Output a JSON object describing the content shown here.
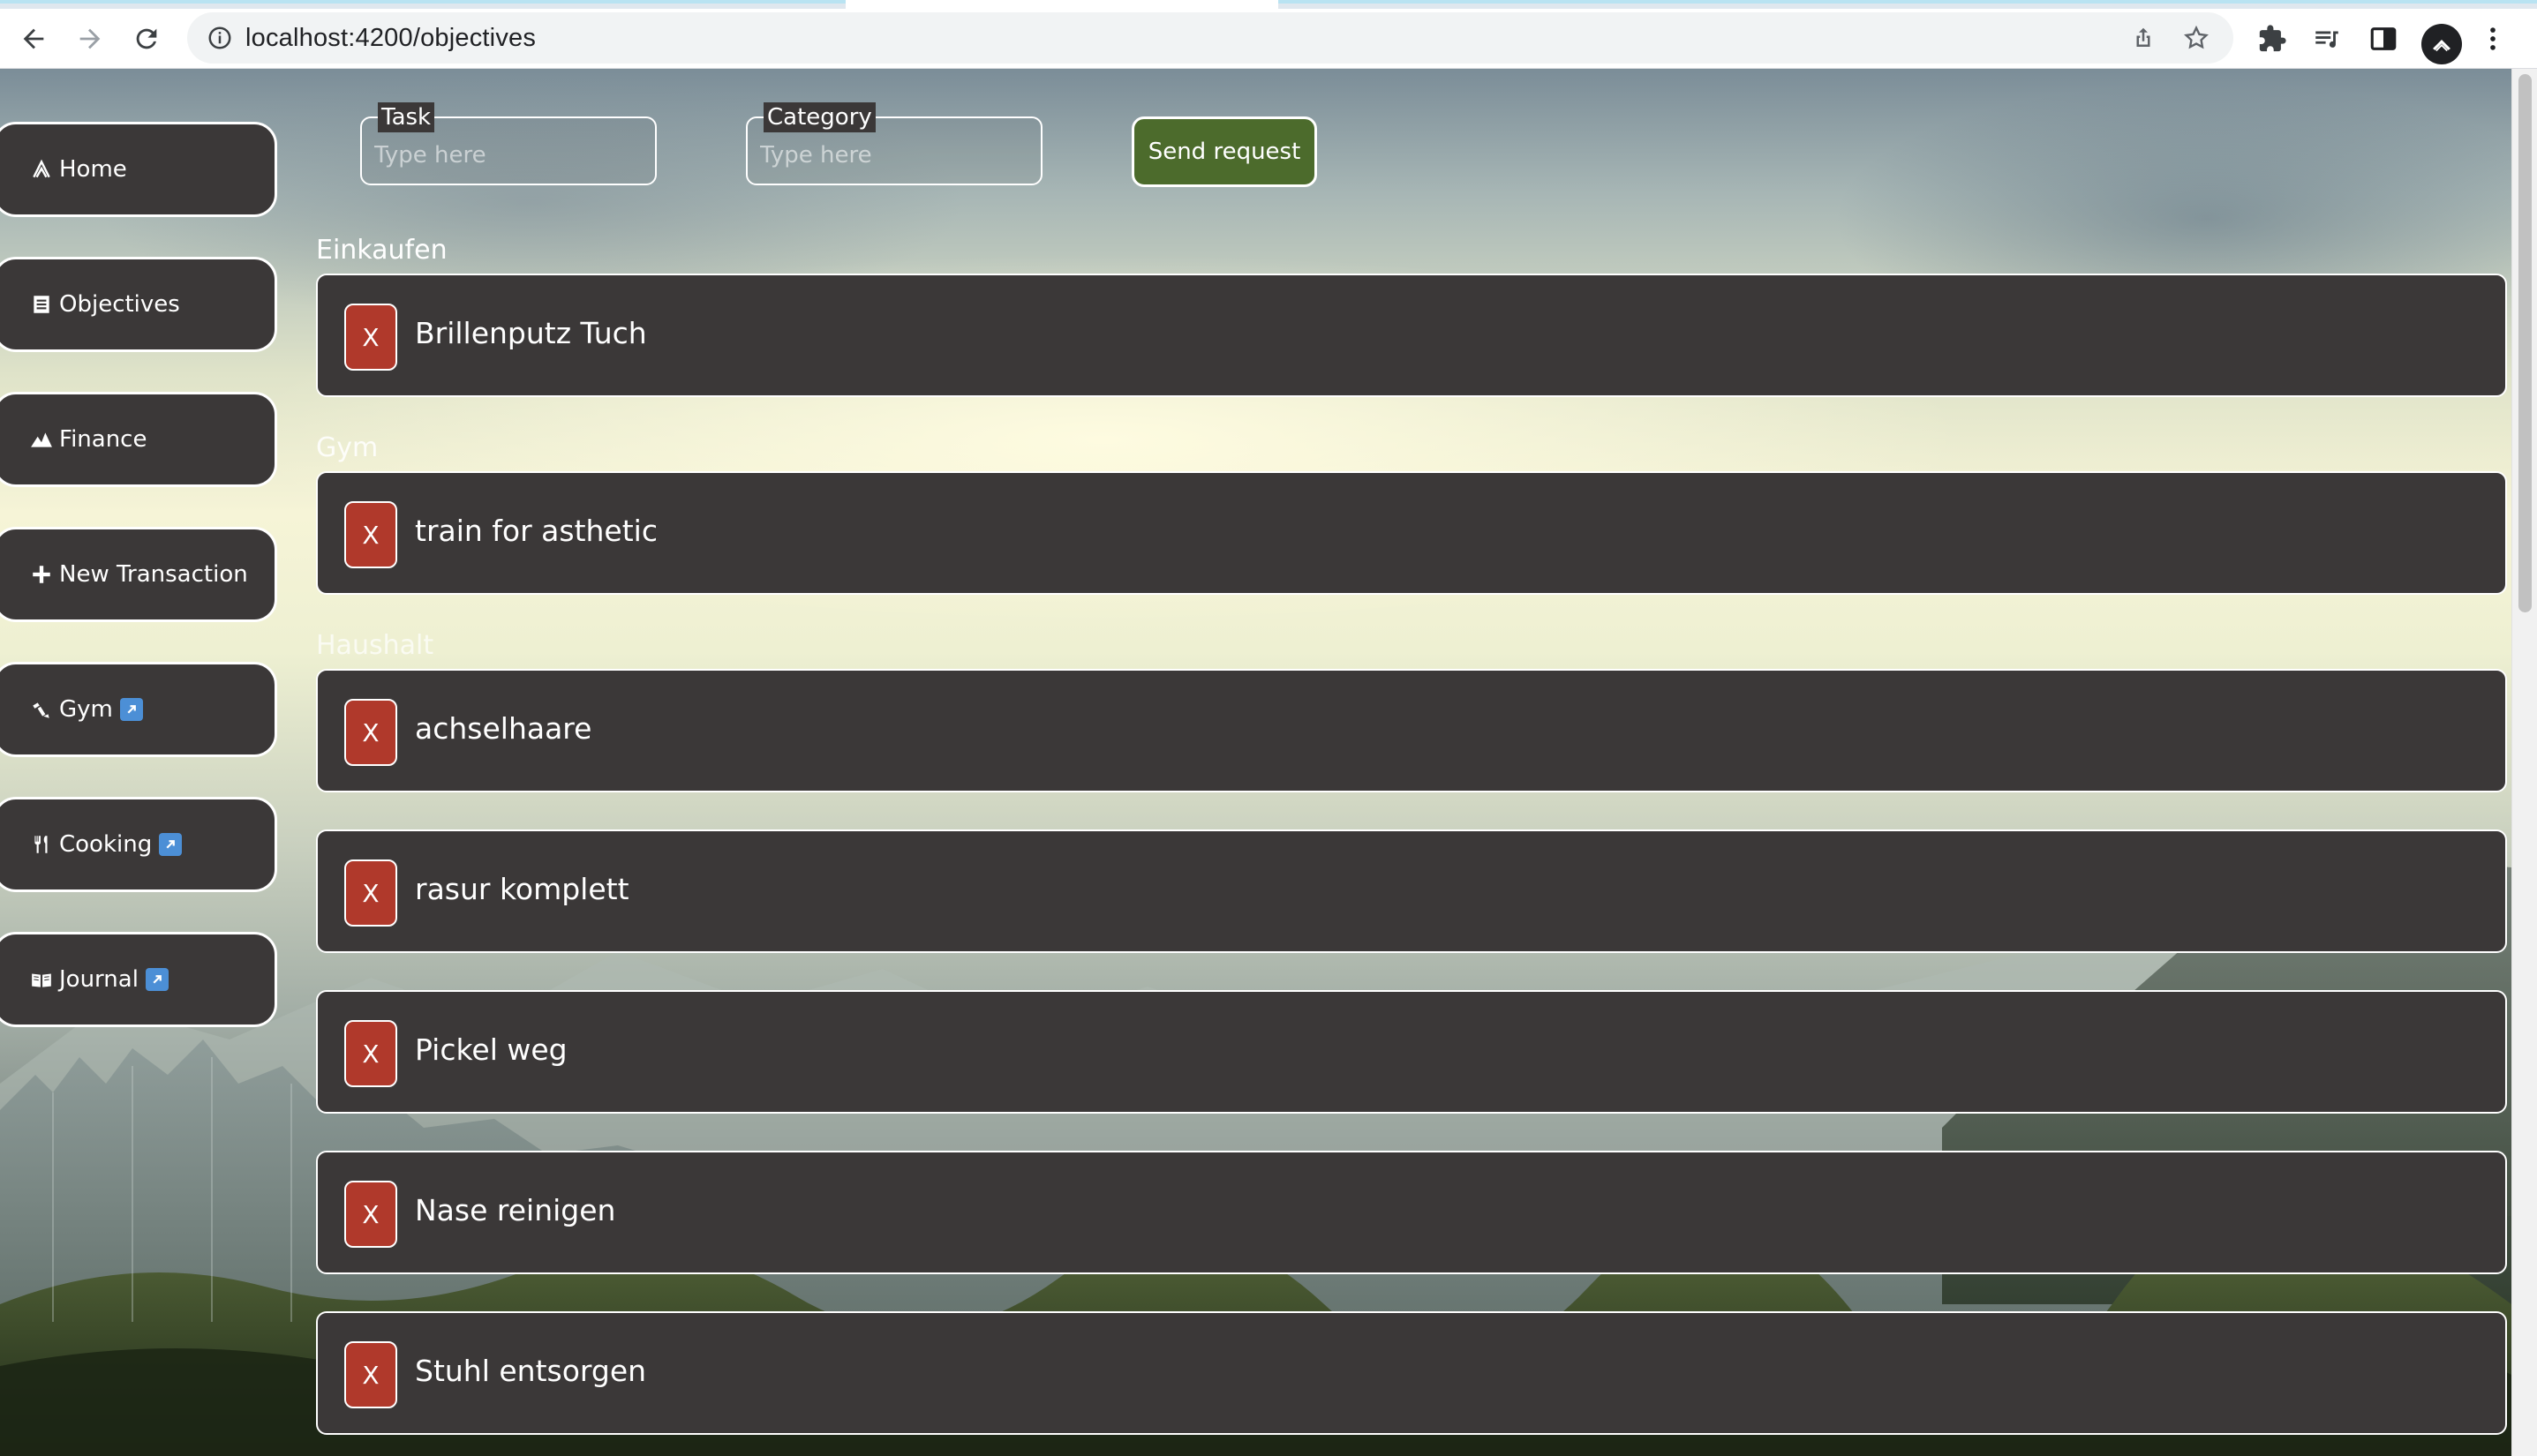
{
  "browser": {
    "url": "localhost:4200/objectives"
  },
  "sidebar": {
    "items": [
      {
        "label": "Home",
        "icon": "home-icon",
        "external": false
      },
      {
        "label": "Objectives",
        "icon": "list-icon",
        "external": false
      },
      {
        "label": "Finance",
        "icon": "chart-icon",
        "external": false
      },
      {
        "label": "New Transaction",
        "icon": "plus-icon",
        "external": false
      },
      {
        "label": "Gym",
        "icon": "dumbbell-icon",
        "external": true
      },
      {
        "label": "Cooking",
        "icon": "cutlery-icon",
        "external": true
      },
      {
        "label": "Journal",
        "icon": "book-icon",
        "external": true
      }
    ]
  },
  "form": {
    "task_label": "Task",
    "task_placeholder": "Type here",
    "category_label": "Category",
    "category_placeholder": "Type here",
    "send_label": "Send request"
  },
  "groups": [
    {
      "category": "Einkaufen",
      "items": [
        "Brillenputz Tuch"
      ]
    },
    {
      "category": "Gym",
      "items": [
        "train for asthetic"
      ]
    },
    {
      "category": "Haushalt",
      "items": [
        "achselhaare",
        "rasur komplett",
        "Pickel weg",
        "Nase reinigen",
        "Stuhl entsorgen"
      ]
    }
  ],
  "delete_label": "X",
  "colors": {
    "panel": "#3b3838",
    "delete": "#b0392b",
    "send": "#4c6b2c",
    "border": "#ffffff"
  }
}
